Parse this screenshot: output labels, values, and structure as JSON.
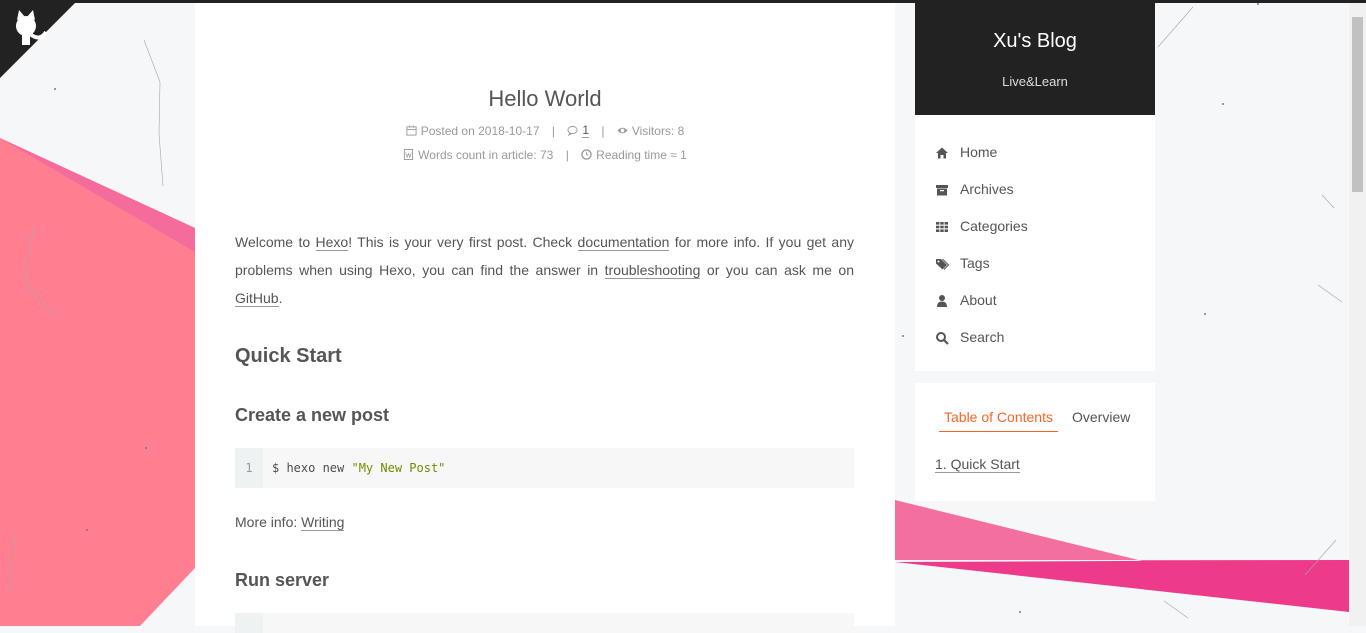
{
  "post": {
    "title": "Hello World",
    "posted_label": "Posted on",
    "posted_date": "2018-10-17",
    "comments": "1",
    "visitors": "Visitors: 8",
    "words": "Words count in article: 73",
    "reading": "Reading time ≈ 1"
  },
  "content": {
    "p1_a": "Welcome to ",
    "p1_link1": "Hexo",
    "p1_b": "! This is your very first post. Check ",
    "p1_link2": "documentation",
    "p1_c": " for more info. If you get any problems when using Hexo, you can find the answer in ",
    "p1_link3": "troubleshooting",
    "p1_d": " or you can ask me on ",
    "p1_link4": "GitHub",
    "p1_e": ".",
    "h2_quick_start": "Quick Start",
    "h3_create_post": "Create a new post",
    "code1_line_no": "1",
    "code1_cmd": "$ hexo new ",
    "code1_str": "\"My New Post\"",
    "more_info_label": "More info: ",
    "more_info_link": "Writing",
    "h3_run_server": "Run server"
  },
  "sidebar": {
    "site_title": "Xu's Blog",
    "site_subtitle": "Live&Learn",
    "menu": [
      {
        "label": "Home",
        "icon": "home-icon"
      },
      {
        "label": "Archives",
        "icon": "archive-icon"
      },
      {
        "label": "Categories",
        "icon": "grid-icon"
      },
      {
        "label": "Tags",
        "icon": "tags-icon"
      },
      {
        "label": "About",
        "icon": "user-icon"
      },
      {
        "label": "Search",
        "icon": "search-icon"
      }
    ],
    "toc_tab": "Table of Contents",
    "overview_tab": "Overview",
    "toc_item": "1. Quick Start"
  },
  "colors": {
    "accent": "#fc6423",
    "header_bg": "#222222",
    "pink_shape": "#ff7e8f",
    "magenta_shape": "#f0368a"
  }
}
